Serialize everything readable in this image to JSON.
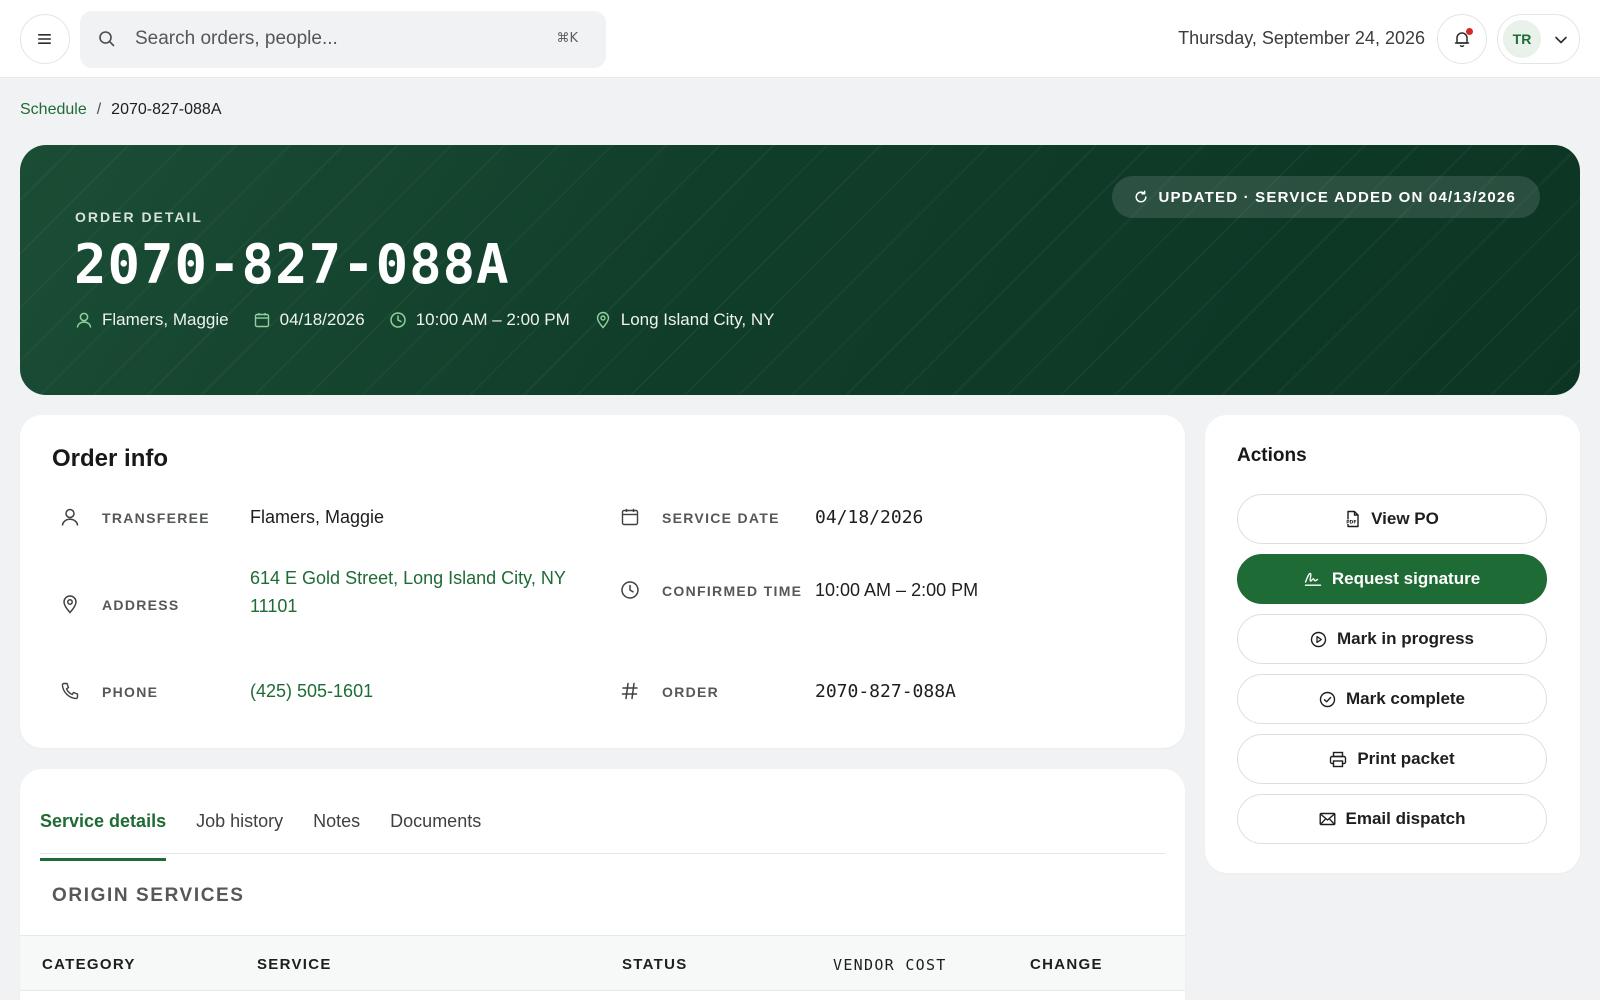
{
  "topbar": {
    "menu_icon": "hamburger-icon",
    "search": {
      "placeholder": "Search orders, people...",
      "value": "",
      "shortcut": "⌘K"
    },
    "date": "Thursday, September 24, 2026",
    "notification_icon": "bell-icon",
    "user_initials": "TR"
  },
  "breadcrumb": {
    "parent": "Schedule",
    "separator": "/",
    "current": "2070-827-088A"
  },
  "hero": {
    "eyebrow": "ORDER DETAIL",
    "order_number": "2070-827-088A",
    "updated_badge": "UPDATED · SERVICE ADDED ON 04/13/2026",
    "meta": {
      "person": "Flamers, Maggie",
      "date": "04/18/2026",
      "time": "10:00 AM – 2:00 PM",
      "location": "Long Island City, NY"
    }
  },
  "order_info": {
    "title": "Order info",
    "transferee": {
      "label": "TRANSFEREE",
      "value": "Flamers, Maggie"
    },
    "address": {
      "label": "ADDRESS",
      "value": "614 E Gold Street, Long Island City, NY 11101"
    },
    "phone": {
      "label": "PHONE",
      "value": "(425) 505-1601"
    },
    "service_date": {
      "label": "SERVICE DATE",
      "value": "04/18/2026"
    },
    "confirmed_time": {
      "label": "CONFIRMED TIME",
      "value": "10:00 AM – 2:00 PM"
    },
    "order": {
      "label": "ORDER",
      "value": "2070-827-088A"
    }
  },
  "tabs": [
    {
      "label": "Service details",
      "active": true
    },
    {
      "label": "Job history",
      "active": false
    },
    {
      "label": "Notes",
      "active": false
    },
    {
      "label": "Documents",
      "active": false
    }
  ],
  "origin_services": {
    "title": "ORIGIN SERVICES",
    "columns": [
      "CATEGORY",
      "SERVICE",
      "STATUS",
      "VENDOR COST",
      "CHANGE"
    ]
  },
  "actions": {
    "title": "Actions",
    "buttons": [
      {
        "label": "View PO",
        "icon": "pdf-file-icon"
      },
      {
        "label": "Request signature",
        "icon": "signature-icon"
      },
      {
        "label": "Mark in progress",
        "icon": "play-circle-icon"
      },
      {
        "label": "Mark complete",
        "icon": "check-circle-icon"
      },
      {
        "label": "Print packet",
        "icon": "printer-icon"
      },
      {
        "label": "Email dispatch",
        "icon": "mail-icon"
      }
    ]
  },
  "colors": {
    "brand_green": "#1f6b35",
    "hero_dark": "#0d3524",
    "notification_dot": "#d62828",
    "page_bg": "#f1f2f4"
  }
}
